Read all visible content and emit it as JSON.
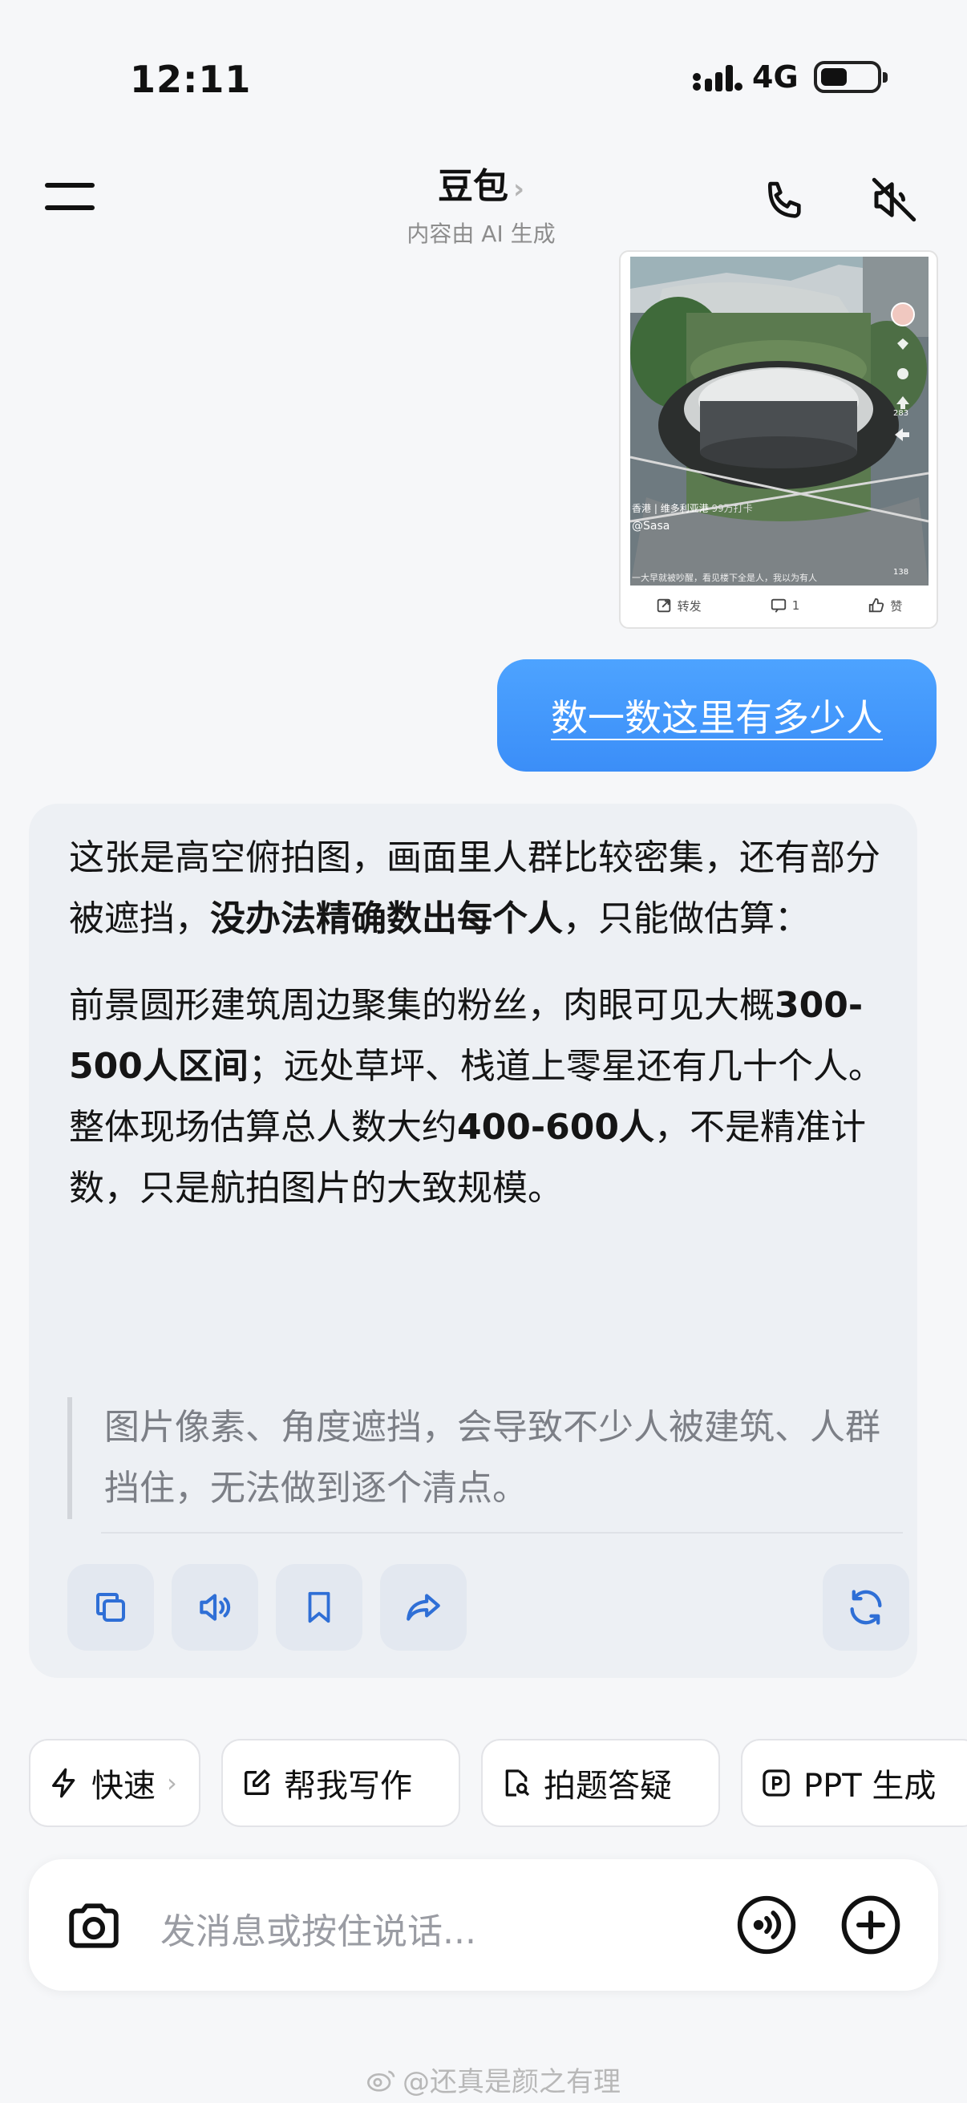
{
  "status_bar": {
    "time": "12:11",
    "network": "4G"
  },
  "header": {
    "title": "豆包",
    "title_chevron": "›",
    "subtitle": "内容由 AI 生成"
  },
  "image_card": {
    "caption_location": "香港",
    "caption_place": "维多利亚港",
    "caption_views": "99万打卡",
    "caption_user": "@Sasa",
    "caption_text": "一大早就被吵醒，看见楼下全是人，我以为有人",
    "like_count": "283",
    "share_count": "138",
    "repost_label": "转发",
    "comment_count": "1",
    "like_label": "赞"
  },
  "user_message": "数一数这里有多少人",
  "reply": {
    "p1_a": "这张是高空俯拍图，画面里人群比较密集，还有部分被遮挡，",
    "p1_b": "没办法精确数出每个人",
    "p1_c": "，只能做估算：",
    "p2_a": "前景圆形建筑周边聚集的粉丝，肉眼可见大概",
    "p2_b": "300-500人区间",
    "p2_c": "；远处草坪、栈道上零星还有几十个人。",
    "p3_a": "整体现场估算总人数大约",
    "p3_b": "400-600人",
    "p3_c": "，不是精准计数，只是航拍图片的大致规模。",
    "quote": "图片像素、角度遮挡，会导致不少人被建筑、人群挡住，无法做到逐个清点。"
  },
  "chips": {
    "fast": "快速",
    "fast_chevron": "›",
    "write": "帮我写作",
    "photo_q": "拍题答疑",
    "ppt": "PPT 生成"
  },
  "input": {
    "placeholder": "发消息或按住说话..."
  },
  "watermark": "@还真是颜之有理",
  "colors": {
    "accent": "#3b8ef8",
    "icon_blue": "#2f6fd6"
  }
}
